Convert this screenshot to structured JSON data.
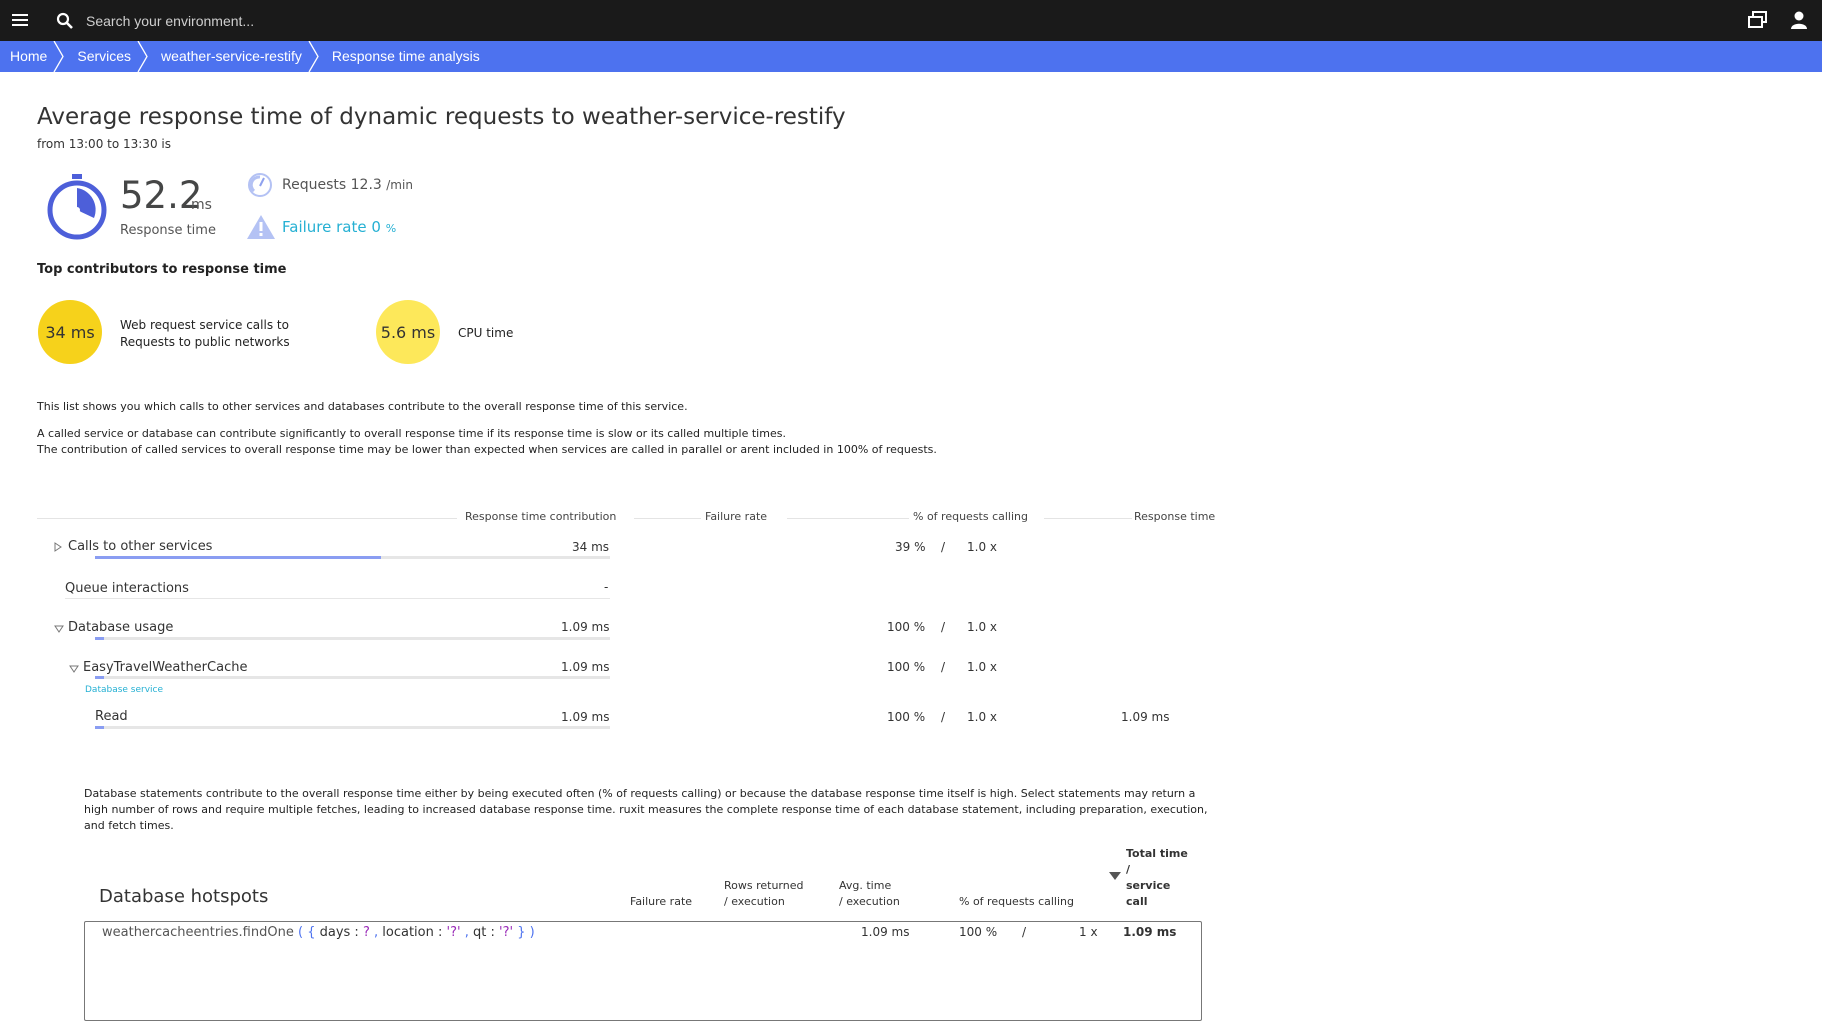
{
  "topbar": {
    "search_placeholder": "Search your environment..."
  },
  "breadcrumbs": [
    "Home",
    "Services",
    "weather-service-restify",
    "Response time analysis"
  ],
  "header": {
    "title": "Average response time of dynamic requests to weather-service-restify",
    "subtitle": "from 13:00 to 13:30 is"
  },
  "metrics": {
    "response_time_value": "52.2",
    "response_time_unit": "ms",
    "response_time_label": "Response time",
    "requests_label": "Requests",
    "requests_value": "12.3",
    "requests_unit": "/min",
    "failure_label": "Failure rate",
    "failure_value": "0",
    "failure_unit": "%"
  },
  "contributors": {
    "heading": "Top contributors to response time",
    "items": [
      {
        "value": "34 ms",
        "label": "Web request service calls to Requests to public networks",
        "color": "#f6d21b"
      },
      {
        "value": "5.6 ms",
        "label": "CPU time",
        "color": "#fde85a"
      }
    ]
  },
  "description": {
    "line1": "This list shows you which calls to other services and databases contribute to the overall response time of this service.",
    "line2": "A called service or database can contribute significantly to overall response time if its response time is slow or its called multiple times.",
    "line3": "The contribution of called services to overall response time may be lower than expected when services are called in parallel or arent included in 100% of requests."
  },
  "table": {
    "headers": {
      "contribution": "Response time contribution",
      "failure": "Failure rate",
      "requests_calling": "% of requests calling",
      "response_time": "Response time"
    },
    "rows": [
      {
        "label": "Calls to other services",
        "contribution": "34 ms",
        "pct": "39 %",
        "sep": "/",
        "times": "1.0 x",
        "response_time": "",
        "bar": 0.65
      },
      {
        "label": "Queue interactions",
        "contribution": "-",
        "pct": "",
        "sep": "",
        "times": "",
        "response_time": "",
        "bar": 0
      },
      {
        "label": "Database usage",
        "contribution": "1.09 ms",
        "pct": "100 %",
        "sep": "/",
        "times": "1.0 x",
        "response_time": "",
        "bar": 0.02
      },
      {
        "label": "EasyTravelWeatherCache",
        "contribution": "1.09 ms",
        "pct": "100 %",
        "sep": "/",
        "times": "1.0 x",
        "response_time": "",
        "bar": 0.02,
        "sublabel": "Database service"
      },
      {
        "label": "Read",
        "contribution": "1.09 ms",
        "pct": "100 %",
        "sep": "/",
        "times": "1.0 x",
        "response_time": "1.09 ms",
        "bar": 0.02
      }
    ]
  },
  "db_description": "Database statements contribute to the overall response time either by being executed often (% of requests calling) or because the database response time itself is high. Select statements may return a high number of rows and require multiple fetches, leading to increased database response time. ruxit measures the complete response time of each database statement, including preparation, execution, and fetch times.",
  "hotspots": {
    "title": "Database hotspots",
    "headers": {
      "failure": "Failure rate",
      "rows_1": "Rows returned",
      "rows_2": "/ execution",
      "avg_1": "Avg. time",
      "avg_2": "/ execution",
      "pct": "% of requests calling",
      "total_1": "Total time",
      "total_2": "/",
      "total_3": "service",
      "total_4": "call"
    },
    "row": {
      "stmt_name": "weathercacheentries.findOne",
      "stmt_open": "( {",
      "k1": "days :",
      "v1": "?",
      "c1": ",",
      "k2": "location :",
      "v2": "'?'",
      "c2": ",",
      "k3": "qt :",
      "v3": "'?'",
      "stmt_close": "} )",
      "avg": "1.09 ms",
      "pct": "100 %",
      "sep": "/",
      "times": "1 x",
      "total": "1.09 ms"
    }
  },
  "colors": {
    "topbar": "#1a1a1a",
    "breadcrumb": "#4d72ef",
    "accent": "#25b0d3",
    "bar": "#8a9df2"
  }
}
